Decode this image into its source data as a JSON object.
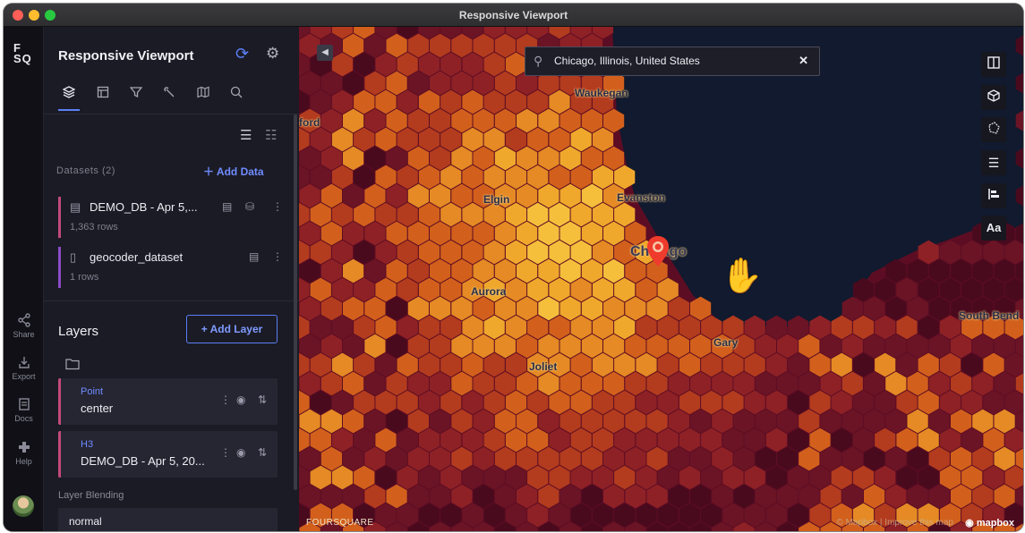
{
  "window": {
    "title": "Responsive Viewport"
  },
  "rail": {
    "logo": "F\nSQ",
    "items": [
      {
        "label": "Share",
        "icon": "share-icon"
      },
      {
        "label": "Export",
        "icon": "export-icon"
      },
      {
        "label": "Docs",
        "icon": "docs-icon"
      },
      {
        "label": "Help",
        "icon": "help-icon"
      }
    ]
  },
  "sidebar": {
    "title": "Responsive Viewport",
    "tabs": [
      {
        "name": "layers",
        "icon": "layers-icon",
        "active": true
      },
      {
        "name": "interactions",
        "icon": "table-icon"
      },
      {
        "name": "filters",
        "icon": "filter-icon"
      },
      {
        "name": "effects",
        "icon": "effects-icon"
      },
      {
        "name": "basemap",
        "icon": "map-icon"
      },
      {
        "name": "analysis",
        "icon": "zoom-icon"
      }
    ],
    "datasets_title": "Datasets (2)",
    "add_data": "Add Data",
    "datasets": [
      {
        "name": "DEMO_DB - Apr 5,...",
        "rows": "1,363 rows",
        "color": "#c34a7b"
      },
      {
        "name": "geocoder_dataset",
        "rows": "1 rows",
        "color": "#8a4cc4"
      }
    ],
    "layers_title": "Layers",
    "add_layer": "+ Add Layer",
    "layers": [
      {
        "type": "Point",
        "name": "center",
        "color": "#c34a7b"
      },
      {
        "type": "H3",
        "name": "DEMO_DB - Apr 5, 20...",
        "color": "#c34a7b"
      }
    ],
    "blending_label": "Layer Blending",
    "blending_value": "normal"
  },
  "map": {
    "search_value": "Chicago, Illinois, United States",
    "controls": [
      "split-map-icon",
      "3d-icon",
      "draw-icon",
      "legend-icon",
      "layer-order-icon",
      "labels-icon"
    ],
    "labels_control_text": "Aa",
    "cities": [
      {
        "name": "Waukegan"
      },
      {
        "name": "Elgin"
      },
      {
        "name": "Evanston"
      },
      {
        "name": "Chicago"
      },
      {
        "name": "Aurora"
      },
      {
        "name": "Gary"
      },
      {
        "name": "Joliet"
      },
      {
        "name": "South Bend"
      },
      {
        "name": "ford"
      }
    ],
    "brand": "FOURSQUARE",
    "attribution": "© Mapbox | Improve this map",
    "mapbox": "mapbox",
    "colors": {
      "water": "#111a2e",
      "hex_low": "#5a0b22",
      "hex_mid": "#c0541c",
      "hex_high": "#f2b632"
    }
  }
}
